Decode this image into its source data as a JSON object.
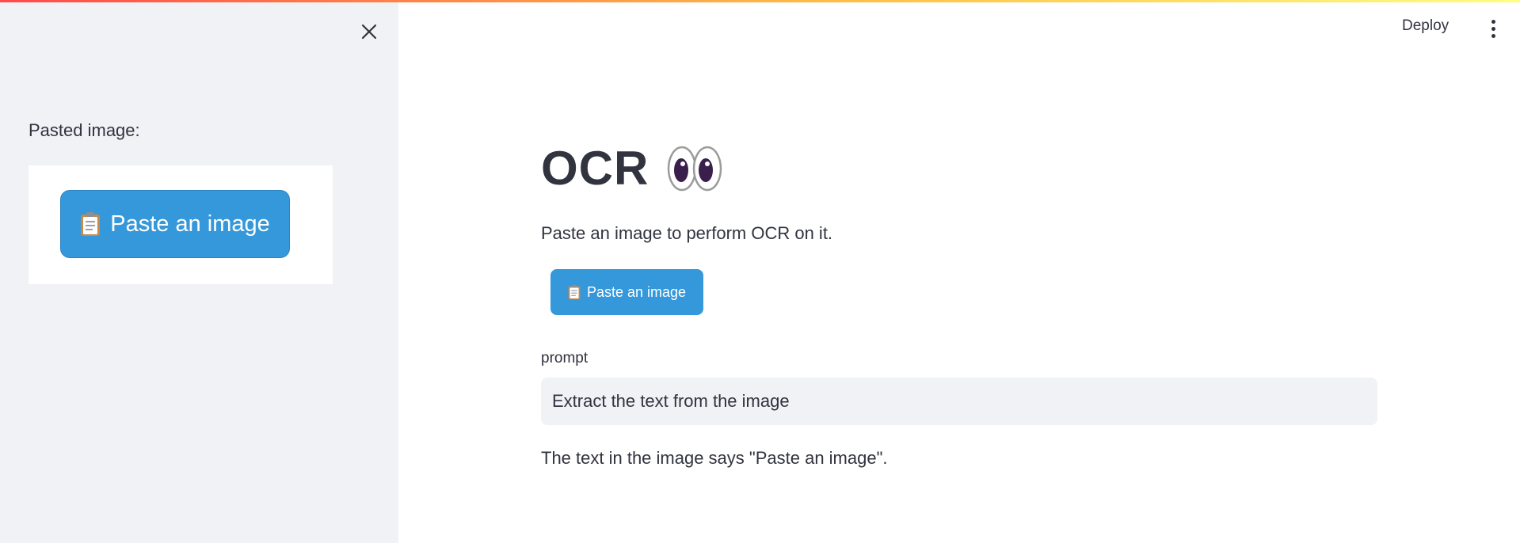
{
  "colors": {
    "accent_gradient_start": "#ff4b4b",
    "accent_gradient_end": "#fffd80",
    "sidebar_bg": "#f0f2f6",
    "button_bg": "#3498db",
    "text": "#31333f"
  },
  "sidebar": {
    "close_icon": "close-icon",
    "pasted_label": "Pasted image:",
    "pasted_image": {
      "button_label": "Paste an image",
      "icon": "clipboard-icon"
    }
  },
  "header": {
    "deploy_label": "Deploy",
    "menu_icon": "vertical-ellipsis-icon"
  },
  "main": {
    "title": "OCR",
    "title_icon": "eyes-icon",
    "subtitle": "Paste an image to perform OCR on it.",
    "paste_button": {
      "label": "Paste an image",
      "icon": "clipboard-icon"
    },
    "prompt": {
      "label": "prompt",
      "value": "Extract the text from the image"
    },
    "result": "The text in the image says \"Paste an image\"."
  }
}
